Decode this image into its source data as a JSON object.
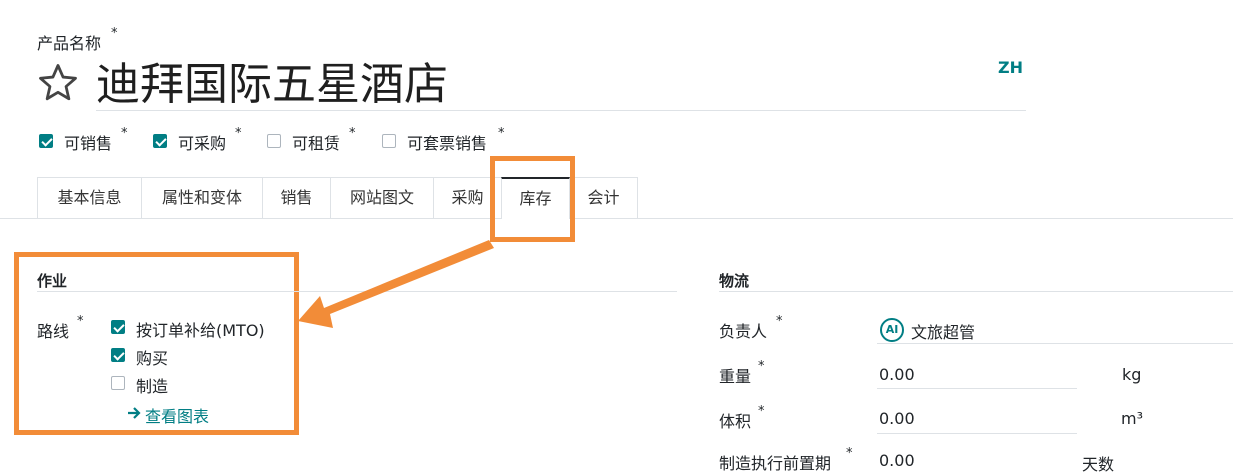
{
  "product": {
    "name_label": "产品名称",
    "required_mark": "*",
    "name": "迪拜国际五星酒店",
    "lang": "ZH"
  },
  "flags": [
    {
      "label": "可销售",
      "checked": true
    },
    {
      "label": "可采购",
      "checked": true
    },
    {
      "label": "可租赁",
      "checked": false
    },
    {
      "label": "可套票销售",
      "checked": false
    }
  ],
  "tabs": [
    {
      "label": "基本信息"
    },
    {
      "label": "属性和变体"
    },
    {
      "label": "销售"
    },
    {
      "label": "网站图文"
    },
    {
      "label": "采购"
    },
    {
      "label": "库存",
      "active": true
    },
    {
      "label": "会计"
    }
  ],
  "operations": {
    "title": "作业",
    "route_label": "路线",
    "routes": [
      {
        "label": "按订单补给(MTO)",
        "checked": true
      },
      {
        "label": "购买",
        "checked": true
      },
      {
        "label": "制造",
        "checked": false
      }
    ],
    "view_chart": "查看图表",
    "arrow_icon": "arrow-right-icon"
  },
  "logistics": {
    "title": "物流",
    "responsible_label": "负责人",
    "responsible_avatar": "AI",
    "responsible_value": "文旅超管",
    "weight_label": "重量",
    "weight_value": "0.00",
    "weight_unit": "kg",
    "volume_label": "体积",
    "volume_value": "0.00",
    "volume_unit": "m³",
    "lead_label": "制造执行前置期",
    "lead_value": "0.00",
    "lead_unit": "天数"
  },
  "colors": {
    "accent": "#017e84",
    "highlight": "#f28c38"
  }
}
